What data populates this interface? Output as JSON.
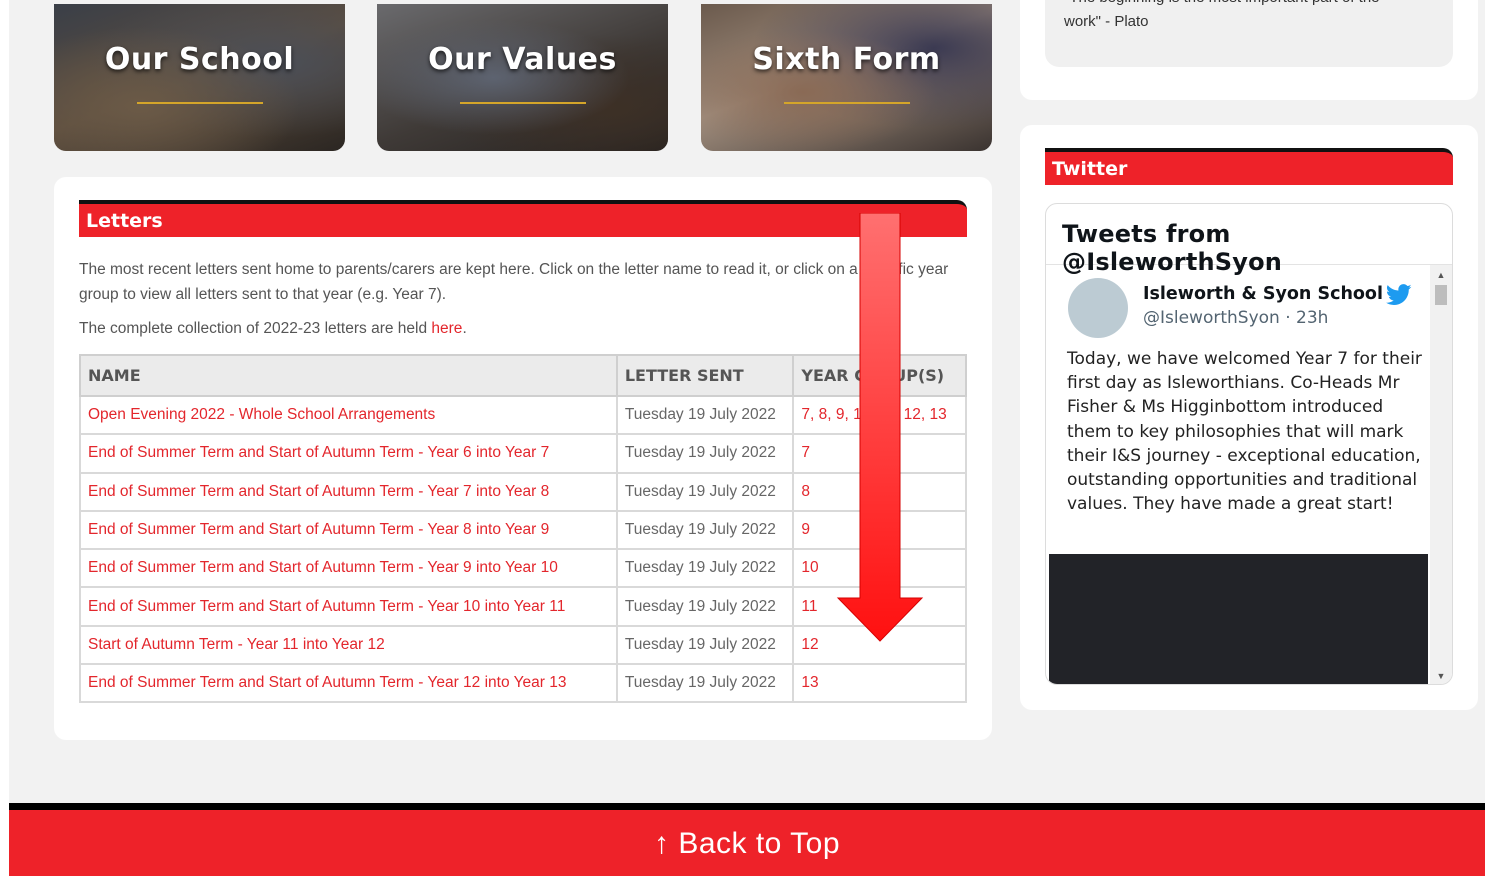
{
  "tiles": [
    {
      "title": "Our School"
    },
    {
      "title": "Our Values"
    },
    {
      "title": "Sixth Form"
    }
  ],
  "letters": {
    "heading": "Letters",
    "intro": "The most recent letters sent home to parents/carers are kept here. Click on the letter name to read it, or click on a specific year group to view all letters sent to that year (e.g. Year 7).",
    "complete_text": "The complete collection of 2022-23 letters are held ",
    "complete_link": "here",
    "complete_end": ".",
    "columns": [
      "NAME",
      "LETTER SENT",
      "YEAR GROUP(S)"
    ],
    "rows": [
      {
        "name": "Open Evening 2022 - Whole School Arrangements",
        "sent": "Tuesday 19 July 2022",
        "years": "7, 8, 9, 10, 11, 12, 13"
      },
      {
        "name": "End of Summer Term and Start of Autumn Term - Year 6 into Year 7",
        "sent": "Tuesday 19 July 2022",
        "years": "7"
      },
      {
        "name": "End of Summer Term and Start of Autumn Term - Year 7 into Year 8",
        "sent": "Tuesday 19 July 2022",
        "years": "8"
      },
      {
        "name": "End of Summer Term and Start of Autumn Term - Year 8 into Year 9",
        "sent": "Tuesday 19 July 2022",
        "years": "9"
      },
      {
        "name": "End of Summer Term and Start of Autumn Term - Year 9 into Year 10",
        "sent": "Tuesday 19 July 2022",
        "years": "10"
      },
      {
        "name": "End of Summer Term and Start of Autumn Term - Year 10 into Year 11",
        "sent": "Tuesday 19 July 2022",
        "years": "11"
      },
      {
        "name": "Start of Autumn Term - Year 11 into Year 12",
        "sent": "Tuesday 19 July 2022",
        "years": "12"
      },
      {
        "name": "End of Summer Term and Start of Autumn Term - Year 12 into Year 13",
        "sent": "Tuesday 19 July 2022",
        "years": "13"
      }
    ]
  },
  "quote": {
    "line1": "\"The beginning is the most important part of the",
    "line2": "work\" - Plato"
  },
  "twitter": {
    "heading": "Twitter",
    "timeline_title": "Tweets from @IsleworthSyon",
    "name": "Isleworth & Syon School",
    "handle": "@IsleworthSyon · 23h",
    "text": "Today, we have welcomed Year 7 for their first day as Isleworthians. Co-Heads Mr Fisher & Ms Higginbottom introduced them to key philosophies that will mark their I&S journey - exceptional education, outstanding opportunities and traditional values. They have made a great start!",
    "icons": [
      "twitter-bird-icon",
      "scroll-up-icon",
      "scroll-down-icon"
    ]
  },
  "footer": {
    "back_to_top": "Back to Top",
    "arrow": "↑"
  },
  "colors": {
    "brand_red": "#ee2229",
    "link_red": "#e3262c",
    "gold_rule": "#d4a52a",
    "twitter_blue": "#1d9bf0"
  }
}
